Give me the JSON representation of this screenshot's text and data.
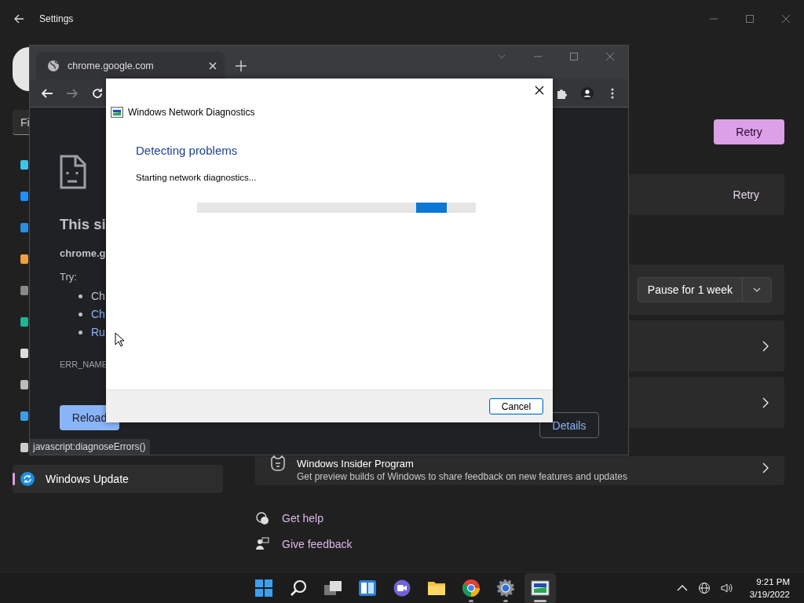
{
  "settings": {
    "title": "Settings",
    "search": {
      "placeholder": "Fi"
    },
    "nav": [
      {
        "label": "Windows Update",
        "selected": true
      }
    ],
    "retry_button": "Retry",
    "cards": [
      {
        "kind": "action",
        "action": "Retry"
      },
      {
        "kind": "dropdown",
        "value": "Pause for 1 week"
      },
      {
        "kind": "link"
      },
      {
        "kind": "link"
      },
      {
        "kind": "link",
        "title": "Windows Insider Program",
        "description": "Get preview builds of Windows to share feedback on new features and updates"
      }
    ],
    "help_links": [
      "Get help",
      "Give feedback"
    ]
  },
  "chrome": {
    "tab": {
      "title": "chrome.google.com"
    },
    "page": {
      "heading": "This si",
      "host": "chrome.g",
      "try_label": "Try:",
      "suggestions": [
        {
          "text": "Ch",
          "link": false
        },
        {
          "text": "Ch",
          "link": true
        },
        {
          "text": "Ru",
          "link": true
        }
      ],
      "error_code": "ERR_NAME",
      "reload": "Reload",
      "details": "Details"
    },
    "status_text": "javascript:diagnoseErrors()"
  },
  "dialog": {
    "title": "Windows Network Diagnostics",
    "heading": "Detecting problems",
    "status": "Starting network diagnostics...",
    "cancel": "Cancel",
    "progress": {
      "indeterminate": true
    }
  },
  "taskbar": {
    "apps": [
      {
        "kind": "start",
        "running": false,
        "active": false
      },
      {
        "kind": "search",
        "running": false,
        "active": false
      },
      {
        "kind": "taskview",
        "running": false,
        "active": false
      },
      {
        "kind": "widgets",
        "running": false,
        "active": false
      },
      {
        "kind": "chat",
        "running": false,
        "active": false
      },
      {
        "kind": "explorer",
        "running": false,
        "active": false
      },
      {
        "kind": "chrome",
        "running": true,
        "active": false
      },
      {
        "kind": "settings",
        "running": true,
        "active": false
      },
      {
        "kind": "diagnostics",
        "running": true,
        "active": true
      }
    ],
    "time": "9:21 PM",
    "date": "3/19/2022"
  }
}
